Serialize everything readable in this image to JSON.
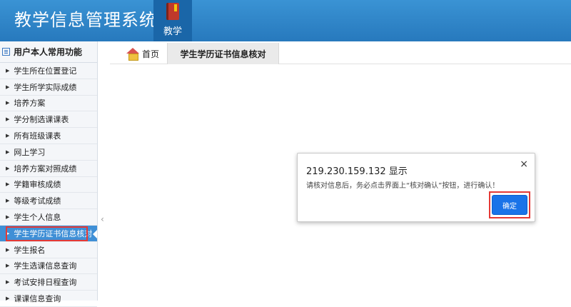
{
  "header": {
    "app_title": "教学信息管理系统",
    "nav_tab_label": "教学"
  },
  "sidebar": {
    "header_label": "用户本人常用功能",
    "items": [
      {
        "label": "学生所在位置登记"
      },
      {
        "label": "学生所学实际成绩"
      },
      {
        "label": "培养方案"
      },
      {
        "label": "学分制选课课表"
      },
      {
        "label": "所有班级课表"
      },
      {
        "label": "网上学习"
      },
      {
        "label": "培养方案对照成绩"
      },
      {
        "label": "学籍审核成绩"
      },
      {
        "label": "等级考试成绩"
      },
      {
        "label": "学生个人信息"
      },
      {
        "label": "学生学历证书信息核对",
        "active": true
      },
      {
        "label": "学生报名"
      },
      {
        "label": "学生选课信息查询"
      },
      {
        "label": "考试安排日程查询"
      },
      {
        "label": "课课信息查询"
      }
    ]
  },
  "tabs": {
    "home_label": "首页",
    "active_label": "学生学历证书信息核对"
  },
  "dialog": {
    "title": "219.230.159.132 显示",
    "message": "请核对信息后，务必点击界面上“核对确认”按钮，进行确认！",
    "ok_label": "确定",
    "close_glyph": "×"
  },
  "colors": {
    "header_bg": "#2779bd",
    "active_item_bg": "#3f8fd6",
    "button_bg": "#1a73e8",
    "highlight": "#e53935"
  }
}
